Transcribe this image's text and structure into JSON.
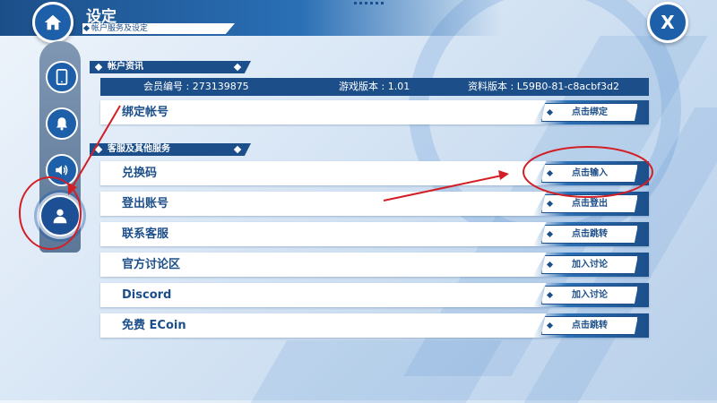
{
  "header": {
    "title": "设定",
    "subtitle": "帐户服务及设定",
    "home_icon": "home-icon",
    "close_icon": "close-icon",
    "close_glyph": "X"
  },
  "sidebar": {
    "items": [
      {
        "name": "phone",
        "icon": "phone-icon"
      },
      {
        "name": "notification",
        "icon": "bell-icon"
      },
      {
        "name": "sound",
        "icon": "speaker-icon"
      },
      {
        "name": "account",
        "icon": "user-icon",
        "active": true
      }
    ]
  },
  "account_section": {
    "title": "帐户资讯",
    "member_id": "会员编号 : 273139875",
    "game_version": "游戏版本 : 1.01",
    "data_version": "资料版本 : L59B0-81-c8acbf3d2",
    "bind_row": {
      "label": "绑定帐号",
      "button": "点击绑定"
    }
  },
  "service_section": {
    "title": "客服及其他服务",
    "rows": [
      {
        "label": "兑换码",
        "button": "点击输入"
      },
      {
        "label": "登出账号",
        "button": "点击登出"
      },
      {
        "label": "联系客服",
        "button": "点击跳转"
      },
      {
        "label": "官方讨论区",
        "button": "加入讨论"
      },
      {
        "label": "Discord",
        "button": "加入讨论"
      },
      {
        "label": "免费 ECoin",
        "button": "点击跳转"
      }
    ]
  },
  "colors": {
    "primary": "#1c4f8a",
    "accent": "#2a6fb5",
    "annotation": "#d21f26"
  }
}
